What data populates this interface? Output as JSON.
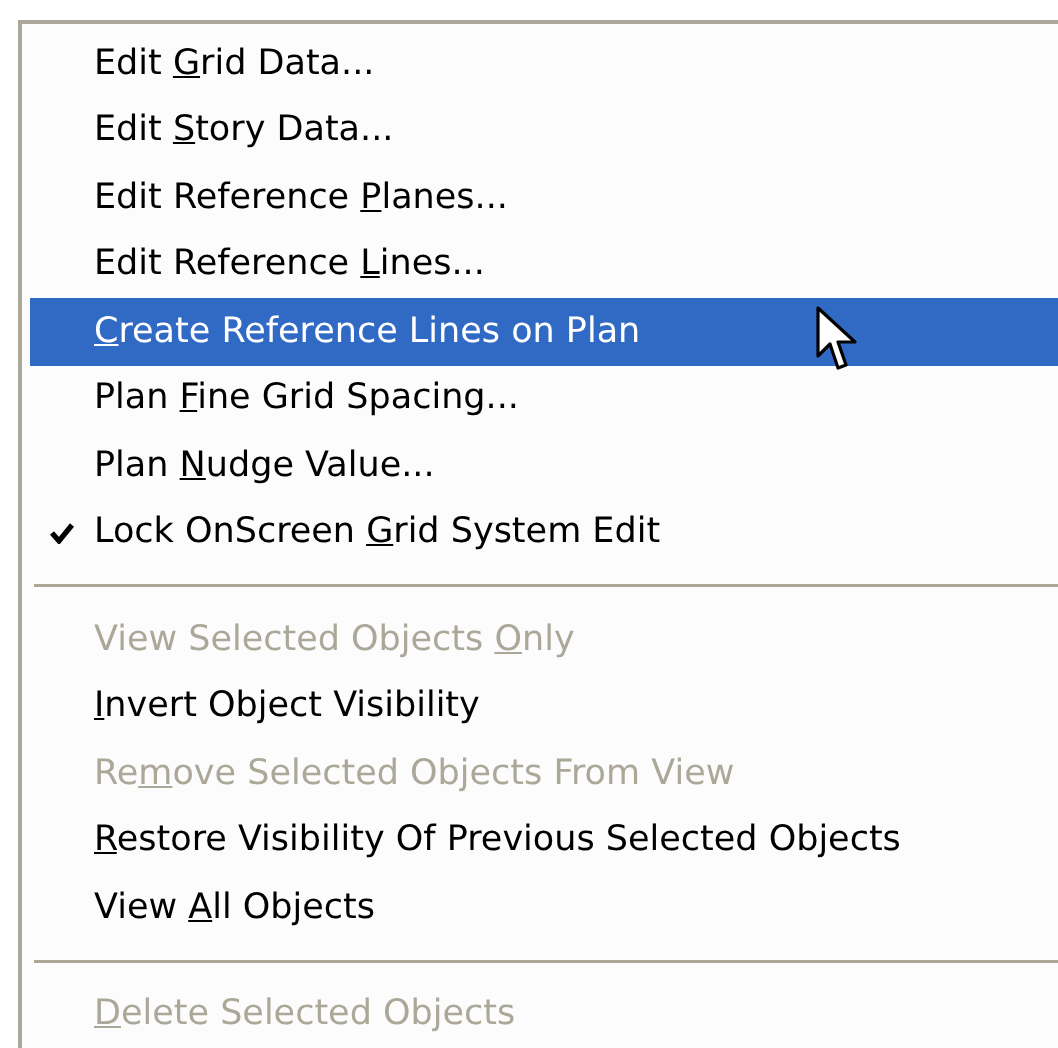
{
  "menu": {
    "items": [
      {
        "kind": "item",
        "text_before": "Edit ",
        "access_key": "G",
        "text_after": "rid Data...",
        "checked": false,
        "disabled": false,
        "selected": false
      },
      {
        "kind": "item",
        "text_before": "Edit ",
        "access_key": "S",
        "text_after": "tory Data...",
        "checked": false,
        "disabled": false,
        "selected": false
      },
      {
        "kind": "item",
        "text_before": "Edit Reference ",
        "access_key": "P",
        "text_after": "lanes...",
        "checked": false,
        "disabled": false,
        "selected": false
      },
      {
        "kind": "item",
        "text_before": "Edit Reference ",
        "access_key": "L",
        "text_after": "ines...",
        "checked": false,
        "disabled": false,
        "selected": false
      },
      {
        "kind": "item",
        "access_key": "C",
        "text_after": "reate Reference Lines on Plan",
        "checked": false,
        "disabled": false,
        "selected": true
      },
      {
        "kind": "item",
        "text_before": "Plan ",
        "access_key": "F",
        "text_after": "ine Grid Spacing...",
        "checked": false,
        "disabled": false,
        "selected": false
      },
      {
        "kind": "item",
        "text_before": "Plan ",
        "access_key": "N",
        "text_after": "udge Value...",
        "checked": false,
        "disabled": false,
        "selected": false
      },
      {
        "kind": "item",
        "text_before": "Lock OnScreen ",
        "access_key": "G",
        "text_after": "rid System Edit",
        "checked": true,
        "disabled": false,
        "selected": false
      },
      {
        "kind": "separator"
      },
      {
        "kind": "item",
        "text_before": "View Selected Objects ",
        "access_key": "O",
        "text_after": "nly",
        "checked": false,
        "disabled": true,
        "selected": false
      },
      {
        "kind": "item",
        "access_key": "I",
        "text_after": "nvert Object Visibility",
        "checked": false,
        "disabled": false,
        "selected": false
      },
      {
        "kind": "item",
        "text_before": "Re",
        "access_key": "m",
        "text_after": "ove Selected Objects From View",
        "checked": false,
        "disabled": true,
        "selected": false
      },
      {
        "kind": "item",
        "access_key": "R",
        "text_after": "estore Visibility Of Previous Selected Objects",
        "checked": false,
        "disabled": false,
        "selected": false
      },
      {
        "kind": "item",
        "text_before": "View ",
        "access_key": "A",
        "text_after": "ll Objects",
        "checked": false,
        "disabled": false,
        "selected": false
      },
      {
        "kind": "separator"
      },
      {
        "kind": "item",
        "access_key": "D",
        "text_after": "elete Selected Objects",
        "checked": false,
        "disabled": true,
        "selected": false
      }
    ]
  }
}
